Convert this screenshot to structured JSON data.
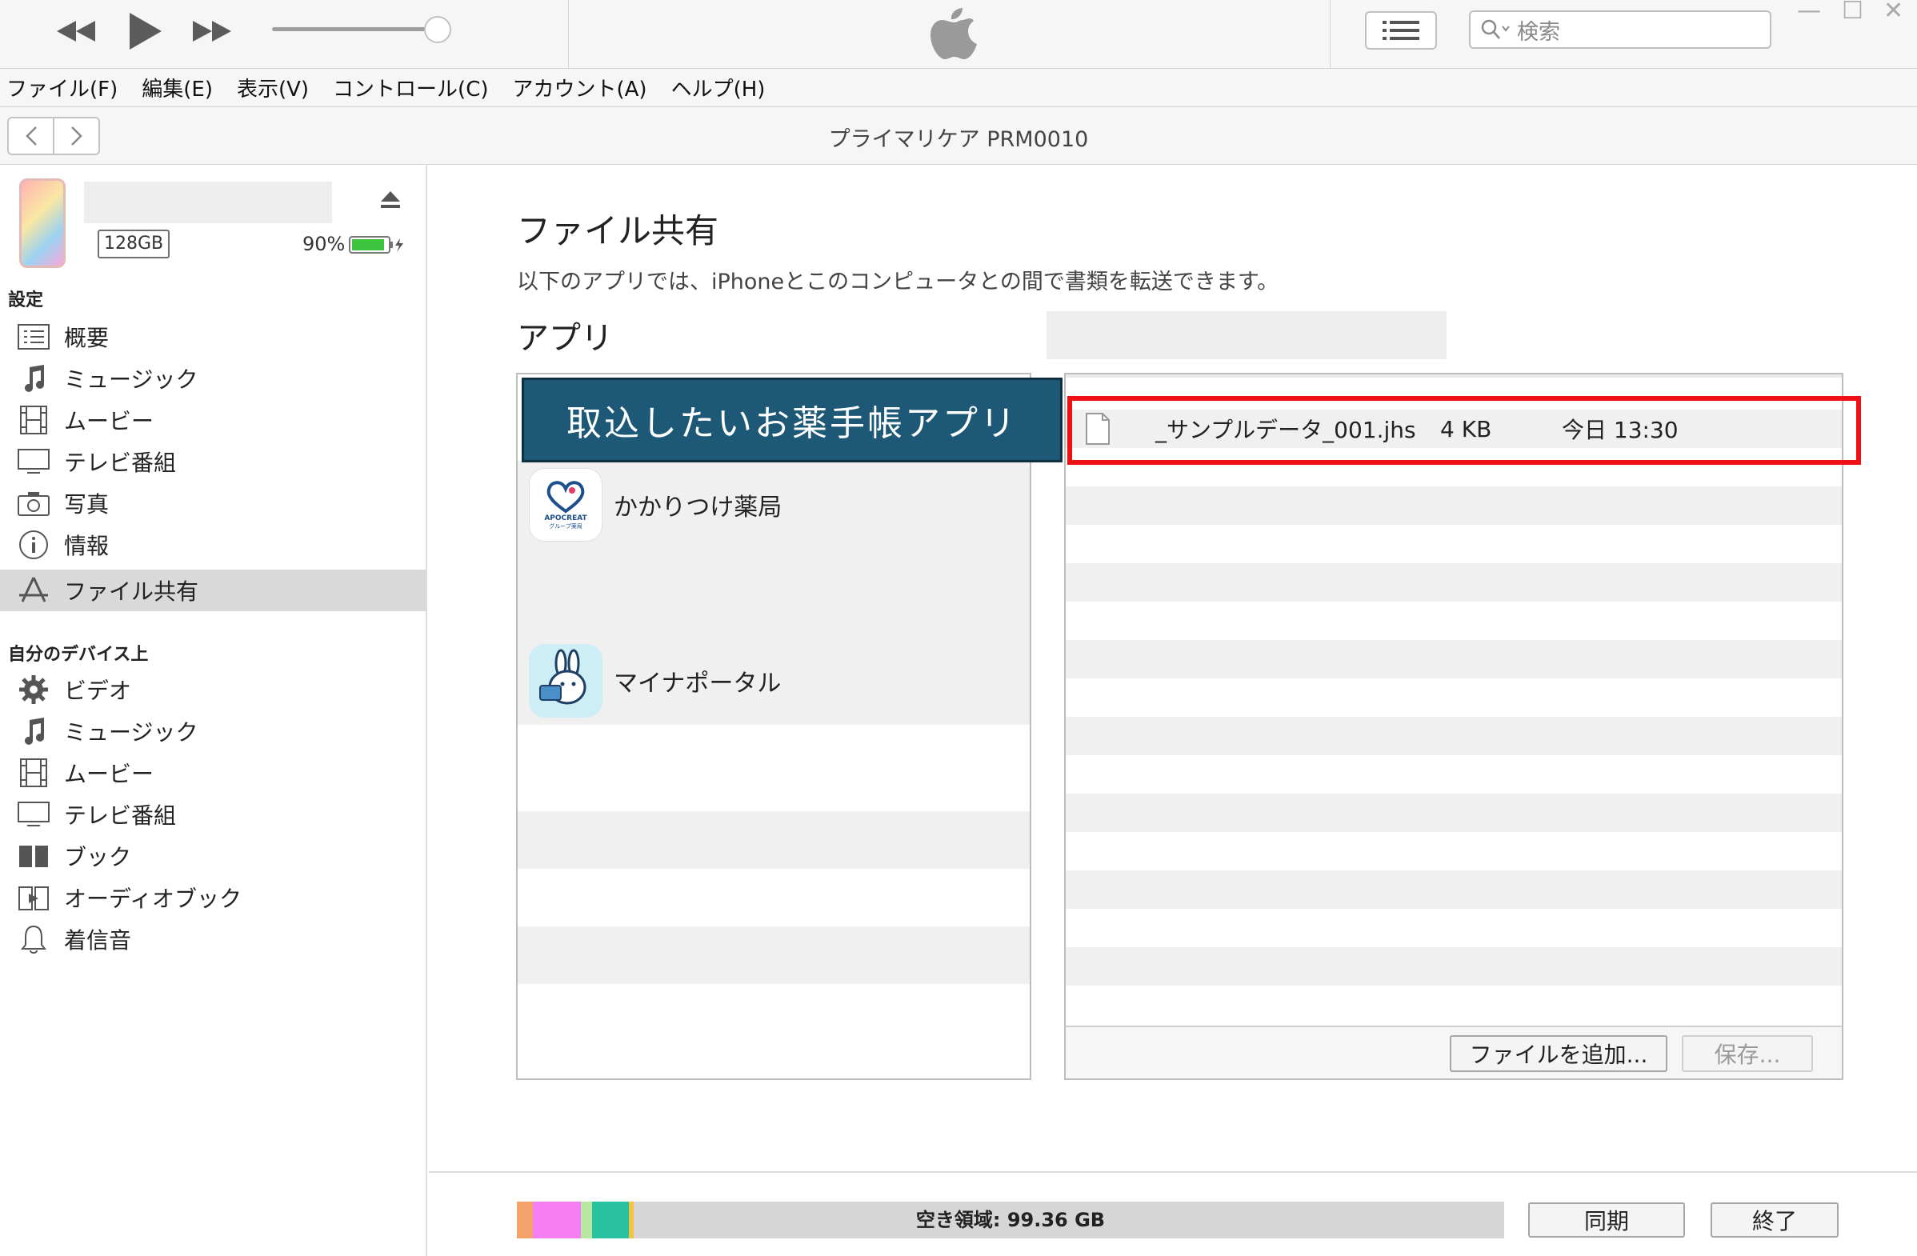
{
  "toolbar": {
    "search_placeholder": "検索",
    "window_controls": [
      "—",
      "☐",
      "✕"
    ]
  },
  "menu": [
    "ファイル(F)",
    "編集(E)",
    "表示(V)",
    "コントロール(C)",
    "アカウント(A)",
    "ヘルプ(H)"
  ],
  "nav": {
    "title": "プライマリケア PRM0010"
  },
  "device": {
    "capacity": "128GB",
    "battery": "90%",
    "battery_level": 0.9
  },
  "sidebar": {
    "settings_header": "設定",
    "settings_items": [
      {
        "label": "概要",
        "icon": "summary-icon"
      },
      {
        "label": "ミュージック",
        "icon": "music-icon"
      },
      {
        "label": "ムービー",
        "icon": "film-icon"
      },
      {
        "label": "テレビ番組",
        "icon": "tv-icon"
      },
      {
        "label": "写真",
        "icon": "camera-icon"
      },
      {
        "label": "情報",
        "icon": "info-icon"
      },
      {
        "label": "ファイル共有",
        "icon": "apps-icon",
        "selected": true
      }
    ],
    "ondevice_header": "自分のデバイス上",
    "ondevice_items": [
      {
        "label": "ビデオ",
        "icon": "gear-icon"
      },
      {
        "label": "ミュージック",
        "icon": "music-icon"
      },
      {
        "label": "ムービー",
        "icon": "film-icon"
      },
      {
        "label": "テレビ番組",
        "icon": "tv-icon"
      },
      {
        "label": "ブック",
        "icon": "book-icon"
      },
      {
        "label": "オーディオブック",
        "icon": "audiobook-icon"
      },
      {
        "label": "着信音",
        "icon": "bell-icon"
      }
    ]
  },
  "main": {
    "title": "ファイル共有",
    "description": "以下のアプリでは、iPhoneとこのコンピュータとの間で書類を転送できます。",
    "apps_header": "アプリ",
    "callout": "取込したいお薬手帳アプリ",
    "apps": [
      {
        "label": "かかりつけ薬局",
        "icon": "apocreat-app-icon",
        "icon_text": [
          "APOCREAT",
          "グループ薬局"
        ]
      },
      {
        "label": "マイナポータル",
        "icon": "mynaportal-app-icon"
      }
    ],
    "files": [
      {
        "name": "_サンプルデータ_001.jhs",
        "size": "4 KB",
        "date": "今日 13:30"
      }
    ],
    "add_file_button": "ファイルを追加...",
    "save_button": "保存..."
  },
  "footer": {
    "free_space": "空き領域: 99.36 GB",
    "sync_button": "同期",
    "done_button": "終了",
    "storage_colors": [
      "#f3a36a",
      "#f57ef2",
      "#b9e6a1",
      "#28c2a2",
      "#f5c542"
    ]
  }
}
